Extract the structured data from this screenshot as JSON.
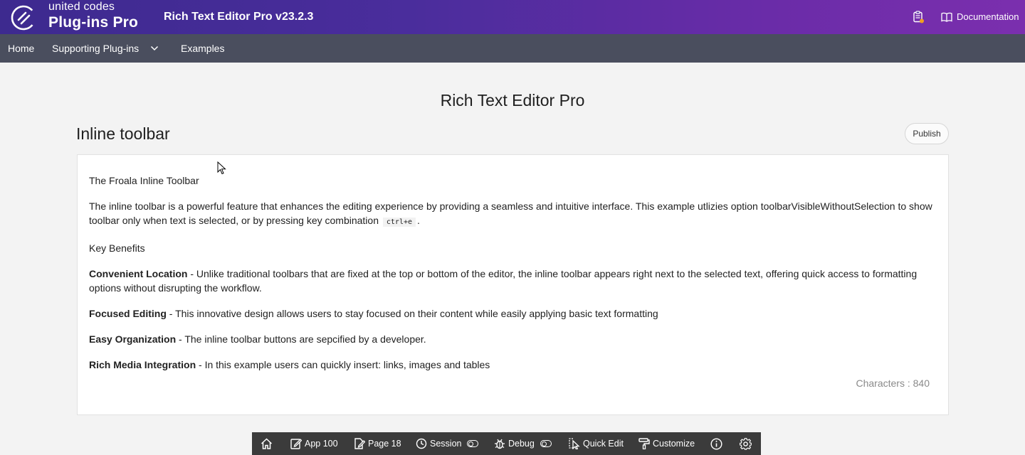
{
  "header": {
    "brand_top": "united codes",
    "brand_bottom": "Plug-ins Pro",
    "app_title": "Rich Text Editor Pro v23.2.3",
    "documentation_label": "Documentation",
    "gradient_start": "#3d2a8f",
    "gradient_end": "#7b2fae"
  },
  "nav": {
    "items": [
      {
        "label": "Home"
      },
      {
        "label": "Supporting Plug-ins",
        "has_dropdown": true
      },
      {
        "label": "Examples"
      }
    ],
    "background": "#4a4e5e"
  },
  "main": {
    "page_title": "Rich Text Editor Pro",
    "region_title": "Inline toolbar",
    "publish_label": "Publish",
    "editor": {
      "heading": "The Froala Inline Toolbar",
      "intro": "The inline toolbar is a powerful feature that enhances the editing experience by providing a seamless and intuitive interface. This example utlizies option toolbarVisibleWithoutSelection to show toolbar only when text is selected, or by pressing key combination",
      "intro_kbd": "ctrl+e",
      "intro_end": ".",
      "key_benefits": "Key Benefits",
      "benefits": [
        {
          "title": "Convenient Location",
          "text": " - Unlike traditional toolbars that are fixed at the top or bottom of the editor, the inline toolbar appears right next to the selected text, offering quick access to formatting options without disrupting the workflow."
        },
        {
          "title": "Focused Editing",
          "text": " - This innovative design allows users to stay focused on their content while easily applying basic text formatting"
        },
        {
          "title": "Easy Organization",
          "text": " - The inline toolbar buttons are sepcified by a developer."
        },
        {
          "title": "Rich Media Integration",
          "text": " - In this example users can quickly insert: links, images and tables"
        }
      ],
      "char_count": "Characters : 840"
    }
  },
  "dev_toolbar": {
    "home_icon": "home-icon",
    "app": "App 100",
    "page": "Page 18",
    "session": "Session",
    "debug": "Debug",
    "quick_edit": "Quick Edit",
    "customize": "Customize",
    "info_icon": "info-icon",
    "settings_icon": "gear-icon"
  }
}
